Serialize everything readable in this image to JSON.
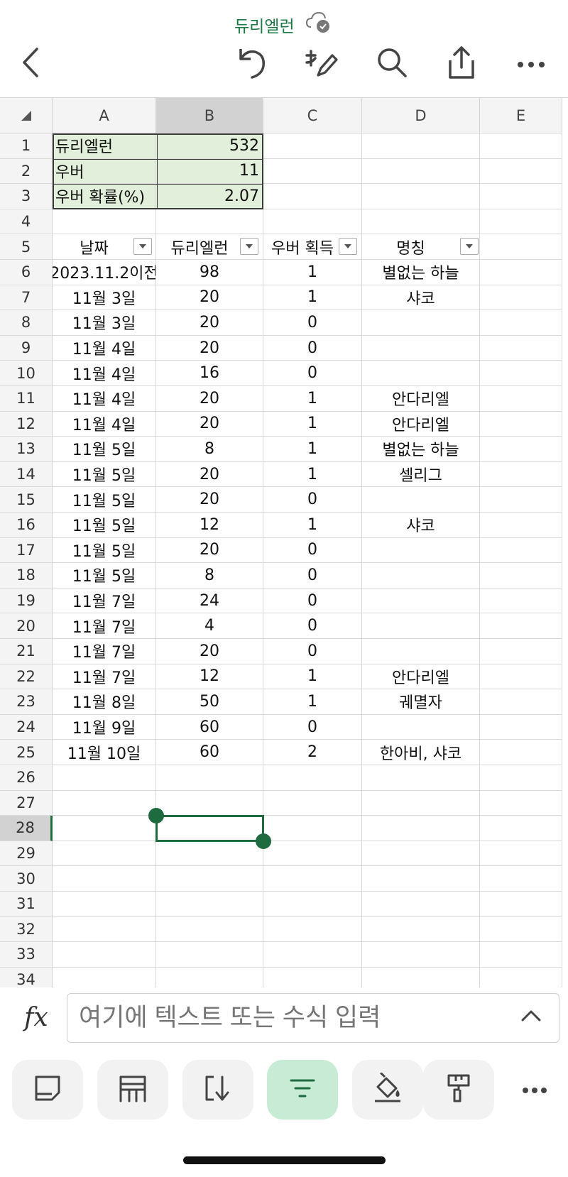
{
  "app": {
    "doc_title": "듀리엘런",
    "icons": {
      "back": "chevron-left-icon",
      "undo": "undo-icon",
      "draw": "handwriting-icon",
      "search": "search-icon",
      "share": "share-icon",
      "more": "more-icon",
      "cloud": "cloud-check-icon"
    }
  },
  "sheet": {
    "columns": [
      "A",
      "B",
      "C",
      "D",
      "E"
    ],
    "rows": [
      "1",
      "2",
      "3",
      "4",
      "5",
      "6",
      "7",
      "8",
      "9",
      "10",
      "11",
      "12",
      "13",
      "14",
      "15",
      "16",
      "17",
      "18",
      "19",
      "20",
      "21",
      "22",
      "23",
      "24",
      "25",
      "26",
      "27",
      "28",
      "29",
      "30",
      "31",
      "32",
      "33",
      "34"
    ],
    "summary": [
      {
        "label": "듀리엘런",
        "value": "532"
      },
      {
        "label": "우버",
        "value": "11"
      },
      {
        "label": "우버 확률(%)",
        "value": "2.07"
      }
    ],
    "table_headers": [
      "날짜",
      "듀리엘런",
      "우버 획득",
      "명칭"
    ],
    "table_rows": [
      [
        "2023.11.2이전",
        "98",
        "1",
        "별없는 하늘"
      ],
      [
        "11월 3일",
        "20",
        "1",
        "샤코"
      ],
      [
        "11월 3일",
        "20",
        "0",
        ""
      ],
      [
        "11월 4일",
        "20",
        "0",
        ""
      ],
      [
        "11월 4일",
        "16",
        "0",
        ""
      ],
      [
        "11월 4일",
        "20",
        "1",
        "안다리엘"
      ],
      [
        "11월 4일",
        "20",
        "1",
        "안다리엘"
      ],
      [
        "11월 5일",
        "8",
        "1",
        "별없는 하늘"
      ],
      [
        "11월 5일",
        "20",
        "1",
        "셀리그"
      ],
      [
        "11월 5일",
        "20",
        "0",
        ""
      ],
      [
        "11월 5일",
        "12",
        "1",
        "샤코"
      ],
      [
        "11월 5일",
        "20",
        "0",
        ""
      ],
      [
        "11월 5일",
        "8",
        "0",
        ""
      ],
      [
        "11월 7일",
        "24",
        "0",
        ""
      ],
      [
        "11월 7일",
        "4",
        "0",
        ""
      ],
      [
        "11월 7일",
        "20",
        "0",
        ""
      ],
      [
        "11월 7일",
        "12",
        "1",
        "안다리엘"
      ],
      [
        "11월 8일",
        "50",
        "1",
        "궤멸자"
      ],
      [
        "11월 9일",
        "60",
        "0",
        ""
      ],
      [
        "11월 10일",
        "60",
        "2",
        "한아비, 샤코"
      ]
    ],
    "selected_column": "B",
    "selected_row": "28"
  },
  "formula_bar": {
    "fx_label": "fx",
    "placeholder": "여기에 텍스트 또는 수식 입력"
  },
  "colors": {
    "accent": "#1e6b3f",
    "title": "#1e7a45",
    "summary_fill": "#e2efda",
    "active_tool": "#c8ebd5"
  }
}
